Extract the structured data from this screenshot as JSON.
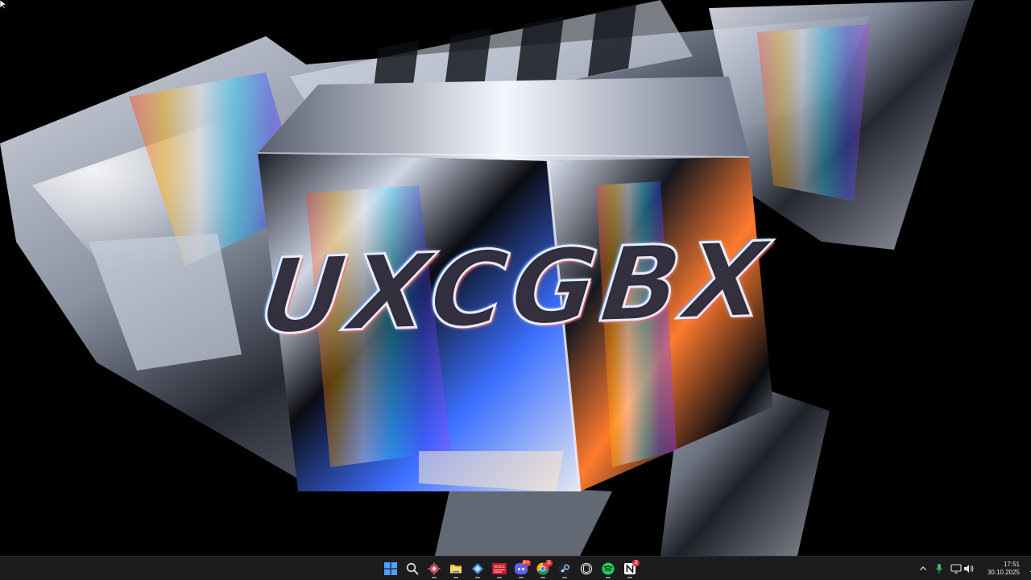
{
  "wallpaper": {
    "wordmark": "UXCGBX",
    "description_icon": "wallpaper-image"
  },
  "taskbar": {
    "apps": [
      {
        "name": "start",
        "icon": "windows-logo-icon"
      },
      {
        "name": "search",
        "icon": "search-icon"
      },
      {
        "name": "app-gear",
        "icon": "gear-app-icon"
      },
      {
        "name": "file-explorer",
        "icon": "folder-icon"
      },
      {
        "name": "app-blue",
        "icon": "blue-app-icon"
      },
      {
        "name": "news-app",
        "icon": "news-app-icon",
        "label": "VOICE"
      },
      {
        "name": "discord",
        "icon": "discord-icon",
        "badge": "9+"
      },
      {
        "name": "chrome",
        "icon": "chrome-icon",
        "badge": "2"
      },
      {
        "name": "steam",
        "icon": "steam-icon"
      },
      {
        "name": "openai",
        "icon": "openai-icon"
      },
      {
        "name": "spotify",
        "icon": "spotify-icon"
      },
      {
        "name": "notion",
        "icon": "notion-icon",
        "badge": "3"
      }
    ],
    "tray": {
      "time": "17:51",
      "date": "30.10.2025"
    },
    "colors": {
      "taskbar_bg": "#1c1c1f",
      "accent": "#4ea1ff",
      "spotify": "#1ed760",
      "badge": "#e03a3a"
    }
  }
}
